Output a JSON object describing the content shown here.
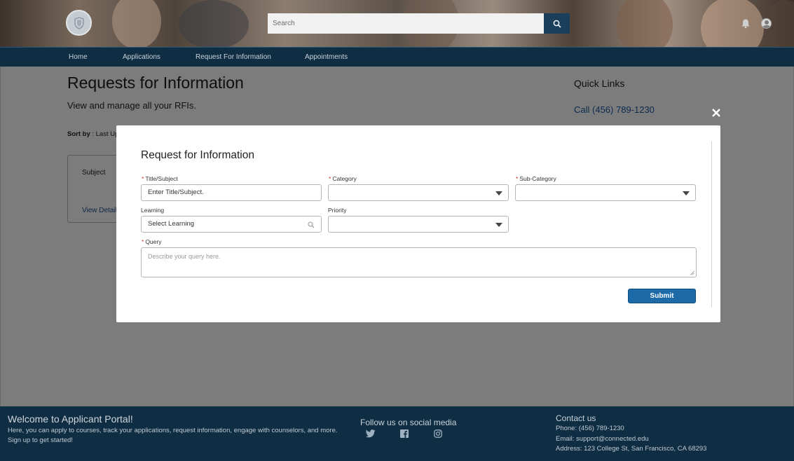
{
  "header": {
    "search_placeholder": "Search"
  },
  "nav": {
    "items": [
      {
        "label": "Home"
      },
      {
        "label": "Applications"
      },
      {
        "label": "Request For Information"
      },
      {
        "label": "Appointments"
      }
    ]
  },
  "page": {
    "title": "Requests for Information",
    "subtitle": "View and manage all your RFIs.",
    "sort_label": "Sort by",
    "sort_value": ": Last Up",
    "card": {
      "subject_label": "Subject",
      "view_details": "View Details"
    }
  },
  "quick_links": {
    "title": "Quick Links",
    "phone": "Call (456) 789-1230"
  },
  "modal": {
    "title": "Request for Information",
    "fields": {
      "title_subject": {
        "label": "Title/Subject",
        "placeholder": "Enter Title/Subject."
      },
      "category": {
        "label": "Category",
        "value": ""
      },
      "sub_category": {
        "label": "Sub-Category",
        "value": ""
      },
      "learning": {
        "label": "Learning",
        "placeholder": "Select Learning"
      },
      "priority": {
        "label": "Priority",
        "value": ""
      },
      "query": {
        "label": "Query",
        "placeholder": "Describe your query here."
      }
    },
    "required_marker": "*",
    "submit_label": "Submit"
  },
  "footer": {
    "welcome_title": "Welcome to Applicant Portal!",
    "welcome_line1": "Here, you can apply to courses, track your applications, request information, engage with counselors, and more.",
    "welcome_line2": "Sign up to get started!",
    "social_title": "Follow us on social media",
    "social_icons": [
      "twitter-icon",
      "facebook-icon",
      "instagram-icon"
    ],
    "contact_title": "Contact us",
    "contact_phone": "Phone: (456) 789-1230",
    "contact_email": "Email: support@connected.edu",
    "contact_address": "Address: 123 College St, San Francisco, CA 68293"
  },
  "colors": {
    "nav_bg": "#0f2e44",
    "accent": "#1c6aa8",
    "overlay": "#7c7c7c",
    "required": "#c23934"
  }
}
